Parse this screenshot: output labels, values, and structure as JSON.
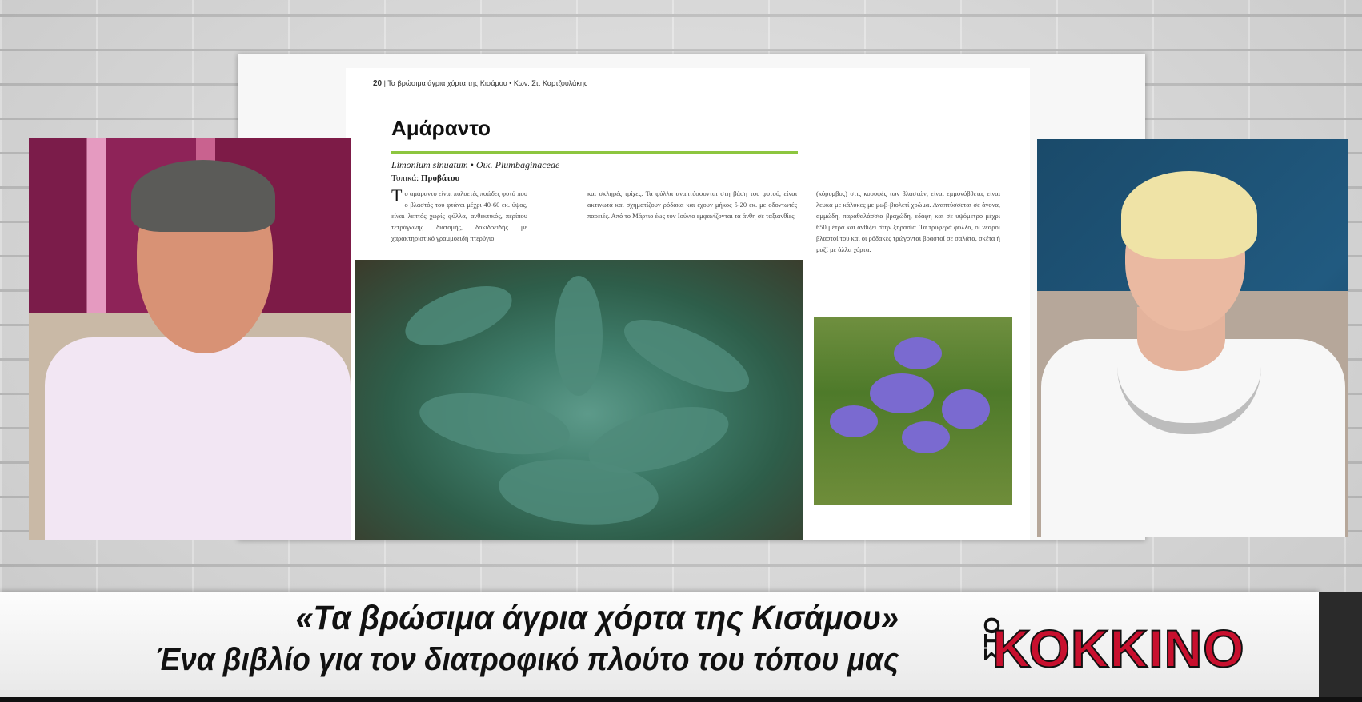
{
  "banner": {
    "title": "«Τα βρώσιμα άγρια χόρτα της Κισάμου»",
    "subtitle": "Ένα βιβλίο για τον διατροφικό πλούτο του τόπου μας"
  },
  "logo": {
    "prefix": "ΣΤΟ",
    "main": "ΚΟΚΚΙΝΟ",
    "color": "#c8102e"
  },
  "book": {
    "page_number": "20",
    "running_header": "Τα βρώσιμα άγρια χόρτα της Κισάμου • Κων. Στ. Καρτζουλάκης",
    "entry_title": "Αμάραντο",
    "latin_name": "Limonium sinuatum • Οικ. Plumbaginaceae",
    "local_name_label": "Τοπικά:",
    "local_name_value": "Προβάτου",
    "col1": "Το αμάραντο είναι πολυετές ποώδες φυτό που ο βλαστός του φτάνει μέχρι 40-60 εκ. ύψος, είναι λεπτός χωρίς φύλλα, ανθεκτικός, περίπου τετράγωνης διατομής, δοκιδοειδής με χαρακτηριστικό γραμμοειδή πτερύγιο",
    "col2": "και σκληρές τρίχες. Τα φύλλα αναπτύσσονται στη βάση του φυτού, είναι ακτινωτά και σχηματίζουν ρόδακα και έχουν μήκος 5-20 εκ. με οδοντωτές παρειές. Από το Μάρτιο έως τον Ιούνιο εμφανίζονται τα άνθη σε ταξιανθίες",
    "col3": "(κόρυμβος) στις κορυφές των βλαστών, είναι εμμονόβθετα, είναι λευκά με κάλυκες με μωβ-βιολετί χρώμα. Αναπτύσσεται σε άγονα, αμμώδη, παραθαλάσσια βραχώδη, εδάφη και σε υψόμετρο μέχρι 650 μέτρα και ανθίζει στην ξηρασία. Τα τρυφερά φύλλα, οι νεαροί βλαστοί του και οι ρόδακες τρώγονται βραστοί σε σαλάτα, σκέτα ή μαζί με άλλα χόρτα."
  },
  "colors": {
    "accent_rule": "#8dc63f"
  }
}
